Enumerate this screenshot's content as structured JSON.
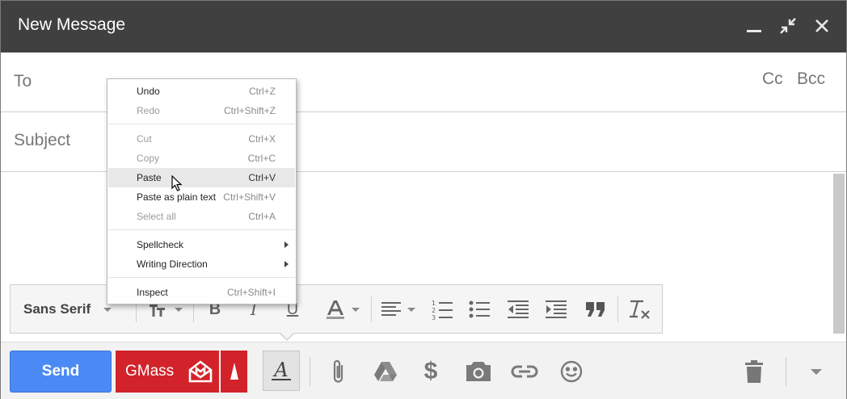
{
  "window": {
    "title": "New Message"
  },
  "fields": {
    "to_label": "To",
    "cc_label": "Cc",
    "bcc_label": "Bcc",
    "subject_label": "Subject"
  },
  "format_toolbar": {
    "font_name": "Sans Serif",
    "icons": [
      "text-size-icon",
      "bold-icon",
      "italic-icon",
      "underline-icon",
      "text-color-icon",
      "align-icon",
      "numbered-list-icon",
      "bulleted-list-icon",
      "indent-less-icon",
      "indent-more-icon",
      "quote-icon",
      "remove-formatting-icon"
    ]
  },
  "bottom_bar": {
    "send_label": "Send",
    "gmass_label": "GMass",
    "icons": [
      "formatting-options-icon",
      "attach-icon",
      "drive-icon",
      "money-icon",
      "photo-icon",
      "link-icon",
      "emoji-icon",
      "trash-icon",
      "more-options-icon"
    ]
  },
  "context_menu": {
    "items": [
      {
        "label": "Undo",
        "shortcut": "Ctrl+Z",
        "enabled": true
      },
      {
        "label": "Redo",
        "shortcut": "Ctrl+Shift+Z",
        "enabled": false
      },
      {
        "label": "Cut",
        "shortcut": "Ctrl+X",
        "enabled": false
      },
      {
        "label": "Copy",
        "shortcut": "Ctrl+C",
        "enabled": false
      },
      {
        "label": "Paste",
        "shortcut": "Ctrl+V",
        "enabled": true,
        "hovered": true
      },
      {
        "label": "Paste as plain text",
        "shortcut": "Ctrl+Shift+V",
        "enabled": true
      },
      {
        "label": "Select all",
        "shortcut": "Ctrl+A",
        "enabled": false
      },
      {
        "label": "Spellcheck",
        "shortcut": "",
        "enabled": true,
        "submenu": true
      },
      {
        "label": "Writing Direction",
        "shortcut": "",
        "enabled": true,
        "submenu": true
      },
      {
        "label": "Inspect",
        "shortcut": "Ctrl+Shift+I",
        "enabled": true
      }
    ]
  },
  "colors": {
    "titlebar": "#404040",
    "send": "#4a8af4",
    "gmass": "#d2232a"
  }
}
